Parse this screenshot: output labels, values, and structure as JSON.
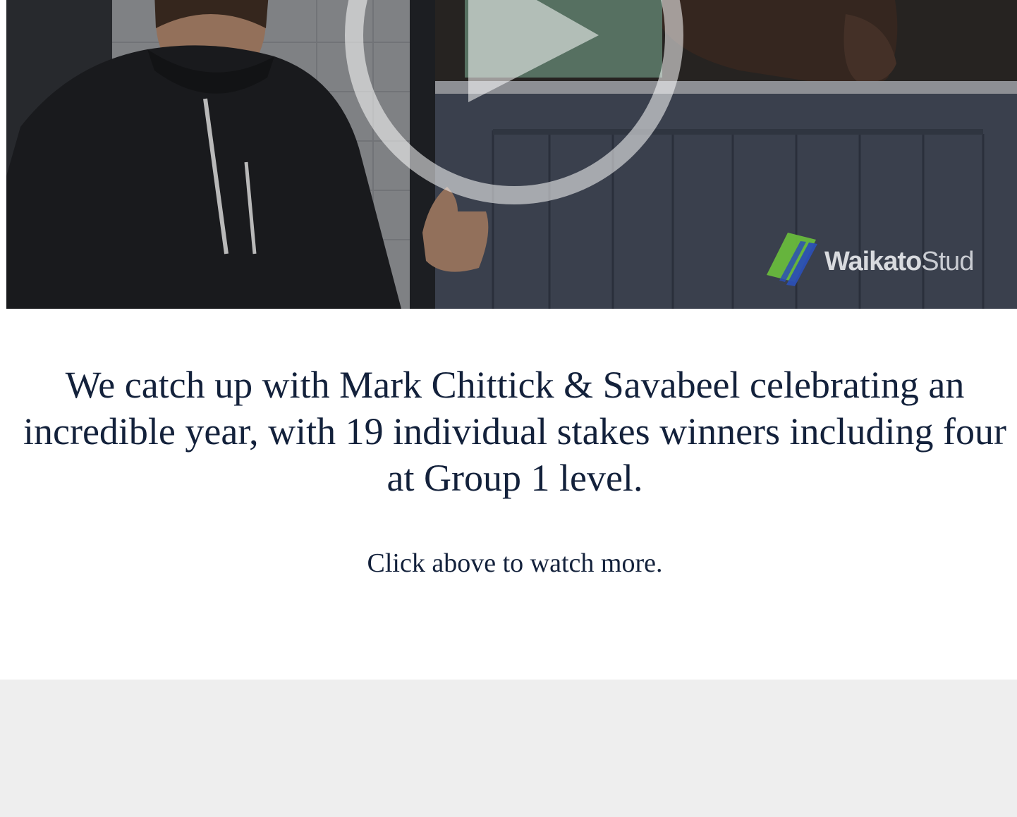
{
  "video": {
    "play_icon": "play-icon",
    "logo": {
      "icon": "waikato-stud-logo-mark",
      "text_bold": "Waikato",
      "text_light": "Stud",
      "colors": {
        "green": "#6cc13c",
        "blue": "#2b4fb4"
      }
    }
  },
  "article": {
    "headline": "We catch up with Mark Chittick & Savabeel celebrating an incredible year, with 19 individual stakes winners including four at Group 1 level.",
    "cta": "Click above to watch more."
  },
  "theme": {
    "text_color": "#13213b",
    "footer_bg": "#eeeeee"
  }
}
